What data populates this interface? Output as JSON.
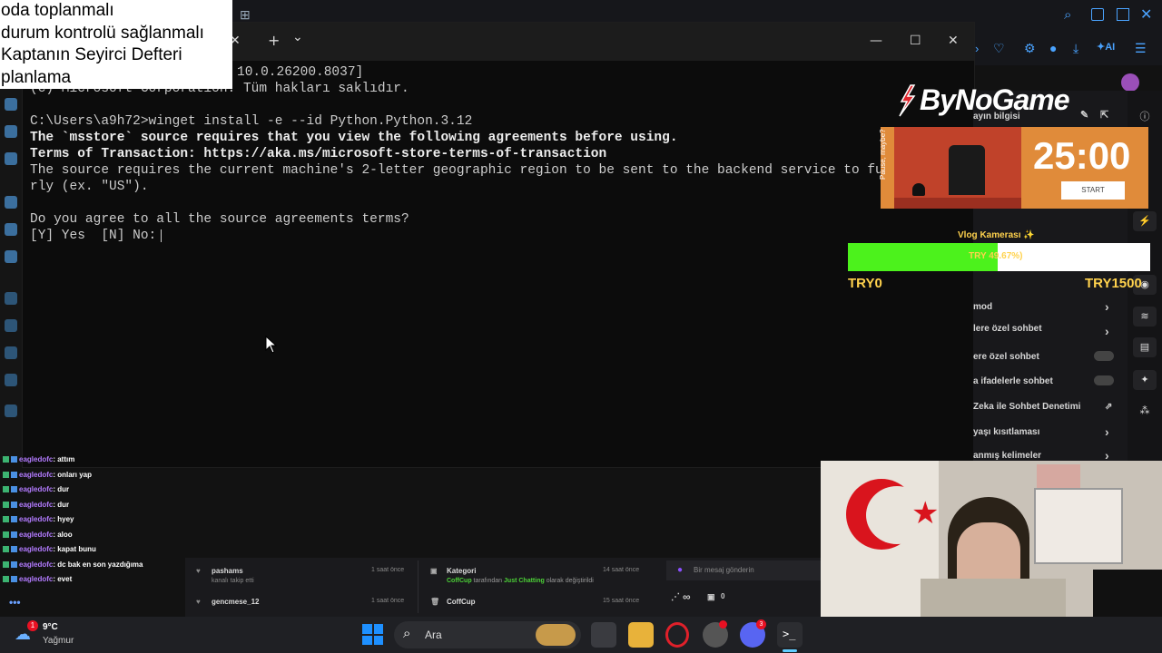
{
  "notes": {
    "lines": [
      "oda toplanmalı",
      "durum kontrolü sağlanmalı",
      "Kaptanın Seyirci Defteri",
      "planlama"
    ]
  },
  "terminal": {
    "lines": [
      {
        "text": "10.0.26200.8037]",
        "bold": false,
        "indent": 228
      },
      {
        "text": "(c) Microsoft Corporation. Tüm hakları saklıdır.",
        "bold": false,
        "indent": 0
      },
      {
        "text": "",
        "bold": false,
        "indent": 0
      },
      {
        "text": "C:\\Users\\a9h72>winget install -e --id Python.Python.3.12",
        "bold": false,
        "indent": 0
      },
      {
        "text": "The `msstore` source requires that you view the following agreements before using.",
        "bold": true,
        "indent": 0
      },
      {
        "text": "Terms of Transaction: https://aka.ms/microsoft-store-terms-of-transaction",
        "bold": true,
        "indent": 0
      },
      {
        "text": "The source requires the current machine's 2-letter geographic region to be sent to the backend service to funct",
        "bold": false,
        "indent": 0
      },
      {
        "text": "rly (ex. \"US\").",
        "bold": false,
        "indent": 0
      },
      {
        "text": "",
        "bold": false,
        "indent": 0
      },
      {
        "text": "Do you agree to all the source agreements terms?",
        "bold": false,
        "indent": 0
      },
      {
        "text": "[Y] Yes  [N] No: ",
        "bold": false,
        "indent": 0
      }
    ],
    "new_tab": "+",
    "dropdown": "⌄",
    "close_tab": "✕",
    "minimize": "—",
    "maximize": "☐",
    "close": "✕"
  },
  "logo": {
    "text": "ByNoGame"
  },
  "timer": {
    "value": "25:00",
    "start": "START",
    "side_text": "Pause, maybe?"
  },
  "donation": {
    "title": "Vlog Kamerası ✨",
    "progress_pct": 49.67,
    "bar_label": "TRY 49.67%)",
    "left": "TRY0",
    "right": "TRY1500"
  },
  "right_panel": {
    "items": [
      {
        "label": "ayın bilgisi",
        "control": "none"
      },
      {
        "label": "mod",
        "control": "chevron"
      },
      {
        "label": "lere özel sohbet",
        "control": "chevron"
      },
      {
        "label": "ere özel sohbet",
        "control": "toggle"
      },
      {
        "label": "a ifadelerle sohbet",
        "control": "toggle"
      },
      {
        "label": "Zeka ile Sohbet Denetimi",
        "control": "external"
      },
      {
        "label": "yaşı kısıtlaması",
        "control": "chevron"
      },
      {
        "label": "anmış kelimeler",
        "control": "chevron"
      }
    ]
  },
  "chat": {
    "messages": [
      {
        "user": "eagledofc",
        "text": ": attım"
      },
      {
        "user": "eagledofc",
        "text": ": onları yap"
      },
      {
        "user": "eagledofc",
        "text": ": dur"
      },
      {
        "user": "eagledofc",
        "text": ": dur"
      },
      {
        "user": "eagledofc",
        "text": ": hyey"
      },
      {
        "user": "eagledofc",
        "text": ": aloo"
      },
      {
        "user": "eagledofc",
        "text": ": kapat bunu"
      },
      {
        "user": "eagledofc",
        "text": ": dc bak en son yazdığıma"
      },
      {
        "user": "eagledofc",
        "text": ": evet"
      }
    ],
    "more": "•••"
  },
  "activity": {
    "follows": [
      {
        "name": "pashams",
        "sub": "kanalı takip etti",
        "time": "1 saat önce"
      },
      {
        "name": "gencmese_12",
        "sub": "",
        "time": "1 saat önce"
      }
    ],
    "category": {
      "title": "Kategori",
      "user": "CoffCup",
      "mid": " tarafından ",
      "game": "Just Chatting",
      "end": " olarak değiştirildi",
      "time": "14 saat önce"
    },
    "raid": {
      "name": "CoffCup",
      "time": "15 saat önce"
    },
    "message_placeholder": "Bir mesaj gönderin",
    "viewer_count": "∞",
    "zero": "0"
  },
  "taskbar": {
    "weather_temp": "9°C",
    "weather_desc": "Yağmur",
    "weather_badge": "1",
    "search": "Ara",
    "discord_badge": "3"
  },
  "colors": {
    "accent_green": "#4cf21c",
    "gold": "#ffd24d",
    "chat_user": "#b37bff",
    "timer_bg": "#e08b3a"
  }
}
